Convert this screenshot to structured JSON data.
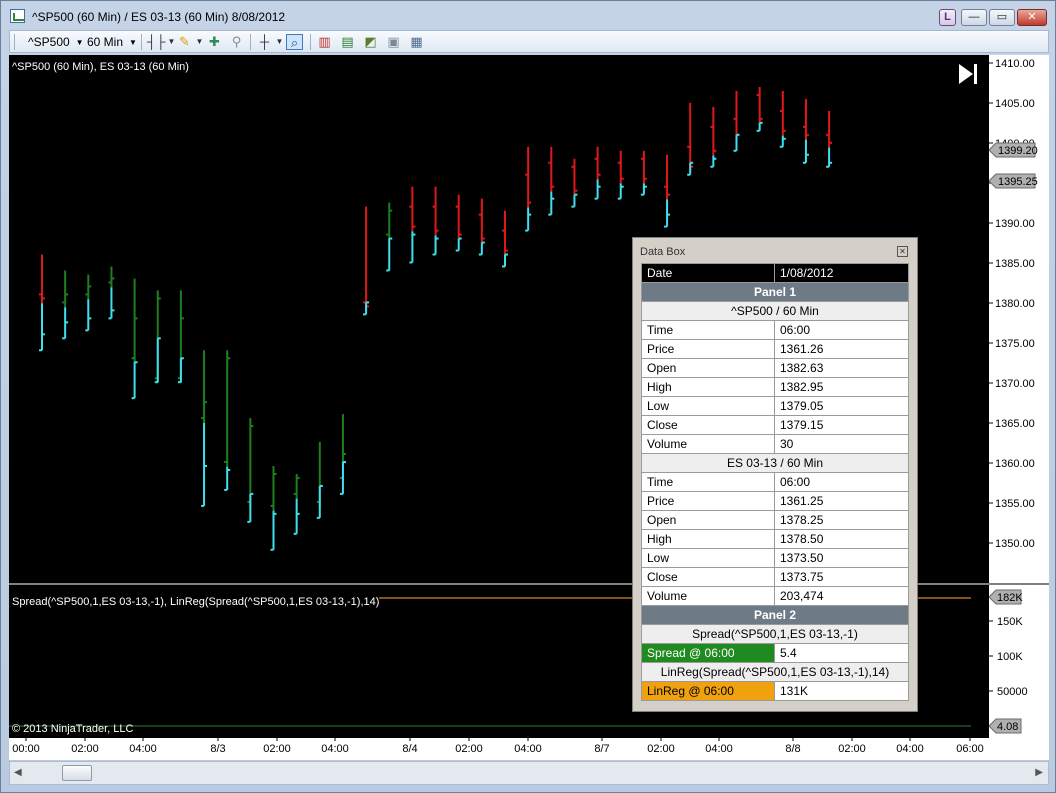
{
  "window": {
    "title": "^SP500 (60 Min) / ES 03-13 (60 Min)  8/08/2012",
    "l_badge": "L",
    "min_glyph": "—",
    "max_glyph": "▭",
    "close_glyph": "✕"
  },
  "toolbar": {
    "instrument": "^SP500",
    "interval": "60 Min"
  },
  "chart": {
    "label": "^SP500 (60 Min), ES 03-13 (60 Min)",
    "indicator_label": "Spread(^SP500,1,ES 03-13,-1), LinReg(Spread(^SP500,1,ES 03-13,-1),14)",
    "copyright": "© 2013 NinjaTrader, LLC",
    "colors": {
      "up": "#1e7f1e",
      "down": "#e01818",
      "sp_tick": "#3ee0f0",
      "es_tick": "#f0a030"
    },
    "price_ticks": [
      "1410.00",
      "1405.00",
      "1400.00",
      "1395.00",
      "1390.00",
      "1385.00",
      "1380.00",
      "1375.00",
      "1370.00",
      "1365.00",
      "1360.00",
      "1355.00",
      "1350.00"
    ],
    "price_markers": [
      "1399.20",
      "1395.25"
    ],
    "indicator_ticks": [
      "150K",
      "100K",
      "50000"
    ],
    "indicator_markers": [
      "182K",
      "4.08"
    ],
    "x_ticks": [
      "00:00",
      "02:00",
      "04:00",
      "8/3",
      "02:00",
      "04:00",
      "8/4",
      "02:00",
      "04:00",
      "8/7",
      "02:00",
      "04:00",
      "8/8",
      "02:00",
      "04:00",
      "06:00"
    ],
    "price_bars": [
      [
        1386,
        1381,
        1380.5,
        1374,
        1374,
        1376
      ],
      [
        1384,
        1380,
        1381,
        1375.5,
        1375.5,
        1377.5
      ],
      [
        1383.5,
        1381,
        1382,
        1376.5,
        1376.5,
        1378
      ],
      [
        1384.5,
        1382.5,
        1383,
        1378,
        1378,
        1379
      ],
      [
        1383,
        1373,
        1378,
        1368,
        1368,
        1372.5
      ],
      [
        1381.5,
        1370.5,
        1380.5,
        1370,
        1370,
        1375.5
      ],
      [
        1381.5,
        1370.5,
        1378,
        1370,
        1370,
        1373
      ],
      [
        1374,
        1365.5,
        1367.5,
        1354.5,
        1354.5,
        1359.5
      ],
      [
        1374,
        1360,
        1373,
        1356.5,
        1356.5,
        1359
      ],
      [
        1365.5,
        1355,
        1364.5,
        1352.5,
        1352.5,
        1356
      ],
      [
        1359.5,
        1354.5,
        1358.5,
        1349,
        1349,
        1353.5
      ],
      [
        1358.5,
        1356,
        1358,
        1351,
        1351,
        1353.5
      ],
      [
        1362.5,
        1355,
        1357,
        1353,
        1353,
        1357
      ],
      [
        1366,
        1358,
        1361,
        1356,
        1356,
        1360
      ],
      [
        1392,
        1380,
        1379.5,
        1378.5,
        1378.5,
        1380
      ],
      [
        1392.5,
        1388.5,
        1391.5,
        1384,
        1384,
        1388
      ],
      [
        1394.5,
        1392,
        1389.5,
        1385,
        1385,
        1388.5
      ],
      [
        1394.5,
        1392,
        1389,
        1386,
        1386,
        1388
      ],
      [
        1393.5,
        1392,
        1388.5,
        1386.5,
        1386.5,
        1388
      ],
      [
        1393,
        1391,
        1388,
        1386,
        1386,
        1387.5
      ],
      [
        1391.5,
        1389,
        1386.5,
        1384.5,
        1384.5,
        1386
      ],
      [
        1399.5,
        1396,
        1392.5,
        1389,
        1389,
        1391
      ],
      [
        1399.5,
        1397.5,
        1394.5,
        1391,
        1391,
        1393
      ],
      [
        1398,
        1397,
        1394,
        1392,
        1392,
        1393.5
      ],
      [
        1399.5,
        1398,
        1396,
        1393,
        1393,
        1394.5
      ],
      [
        1399,
        1397.5,
        1395.5,
        1393,
        1393,
        1394.5
      ],
      [
        1399,
        1398,
        1395.5,
        1393.5,
        1393.5,
        1394.5
      ],
      [
        1398.5,
        1394.5,
        1393.5,
        1389.5,
        1389.5,
        1391
      ],
      [
        1405,
        1399.5,
        1397,
        1396,
        1396,
        1397.5
      ],
      [
        1404.5,
        1402,
        1399,
        1397,
        1397,
        1398
      ],
      [
        1406.5,
        1403,
        1401,
        1399,
        1399,
        1401
      ],
      [
        1407,
        1406,
        1403,
        1401.5,
        1401.5,
        1402.5
      ],
      [
        1406.5,
        1404,
        1401.5,
        1399.5,
        1399.5,
        1400.5
      ],
      [
        1405.5,
        1402,
        1401,
        1397.5,
        1397.5,
        1398.5
      ],
      [
        1404,
        1401,
        1400,
        1397,
        1397,
        1397.5
      ]
    ]
  },
  "databox": {
    "title": "Data Box",
    "rows": [
      {
        "type": "hdr",
        "k": "Date",
        "v": "1/08/2012"
      },
      {
        "type": "panel",
        "text": "Panel 1"
      },
      {
        "type": "sub",
        "text": "^SP500 / 60 Min"
      },
      {
        "type": "kv",
        "k": "Time",
        "v": "06:00"
      },
      {
        "type": "kv",
        "k": "Price",
        "v": "1361.26"
      },
      {
        "type": "kv",
        "k": "Open",
        "v": "1382.63"
      },
      {
        "type": "kv",
        "k": "High",
        "v": "1382.95"
      },
      {
        "type": "kv",
        "k": "Low",
        "v": "1379.05"
      },
      {
        "type": "kv",
        "k": "Close",
        "v": "1379.15"
      },
      {
        "type": "kv",
        "k": "Volume",
        "v": "30"
      },
      {
        "type": "sub",
        "text": "ES 03-13 / 60 Min"
      },
      {
        "type": "kv",
        "k": "Time",
        "v": "06:00"
      },
      {
        "type": "kv",
        "k": "Price",
        "v": "1361.25"
      },
      {
        "type": "kv",
        "k": "Open",
        "v": "1378.25"
      },
      {
        "type": "kv",
        "k": "High",
        "v": "1378.50"
      },
      {
        "type": "kv",
        "k": "Low",
        "v": "1373.50"
      },
      {
        "type": "kv",
        "k": "Close",
        "v": "1373.75"
      },
      {
        "type": "kv",
        "k": "Volume",
        "v": "203,474"
      },
      {
        "type": "panel",
        "text": "Panel 2"
      },
      {
        "type": "sub",
        "text": "Spread(^SP500,1,ES 03-13,-1)"
      },
      {
        "type": "kv",
        "k": "Spread @ 06:00",
        "v": "5.4",
        "kclass": "green"
      },
      {
        "type": "sub",
        "text": "LinReg(Spread(^SP500,1,ES 03-13,-1),14)"
      },
      {
        "type": "kv",
        "k": "LinReg @ 06:00",
        "v": "131K",
        "kclass": "orange"
      }
    ]
  }
}
